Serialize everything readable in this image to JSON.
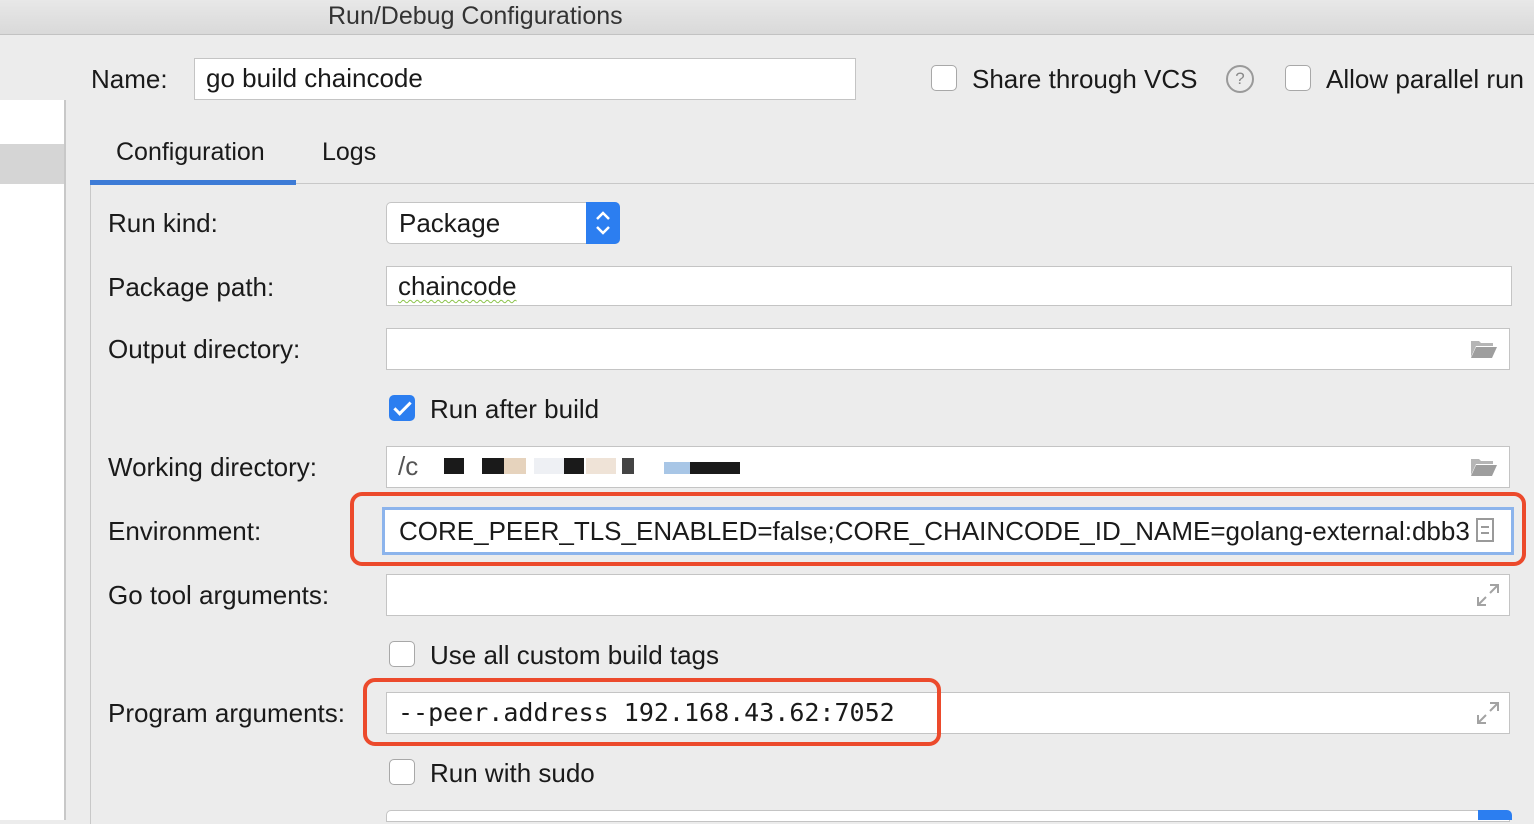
{
  "window": {
    "title": "Run/Debug Configurations"
  },
  "header": {
    "name_label": "Name:",
    "name_value": "go build chaincode",
    "share_vcs_label": "Share through VCS",
    "share_vcs_checked": false,
    "allow_parallel_label": "Allow parallel run",
    "allow_parallel_checked": false,
    "help_icon": "question-circle-icon"
  },
  "tabs": [
    {
      "label": "Configuration",
      "active": true
    },
    {
      "label": "Logs",
      "active": false
    }
  ],
  "form": {
    "run_kind": {
      "label": "Run kind:",
      "value": "Package"
    },
    "package_path": {
      "label": "Package path:",
      "value": "chaincode"
    },
    "output_directory": {
      "label": "Output directory:",
      "value": ""
    },
    "run_after_build": {
      "label": "Run after build",
      "checked": true
    },
    "working_directory": {
      "label": "Working directory:",
      "value": "/c"
    },
    "environment": {
      "label": "Environment:",
      "value": "CORE_PEER_TLS_ENABLED=false;CORE_CHAINCODE_ID_NAME=golang-external:dbb3"
    },
    "go_tool_arguments": {
      "label": "Go tool arguments:",
      "value": ""
    },
    "use_all_custom_build_tags": {
      "label": "Use all custom build tags",
      "checked": false
    },
    "program_arguments": {
      "label": "Program arguments:",
      "value": "--peer.address 192.168.43.62:7052"
    },
    "run_with_sudo": {
      "label": "Run with sudo",
      "checked": false
    }
  },
  "colors": {
    "accent": "#2c7ef0",
    "highlight": "#ec4a2c",
    "tab_underline": "#3d7bd6"
  }
}
